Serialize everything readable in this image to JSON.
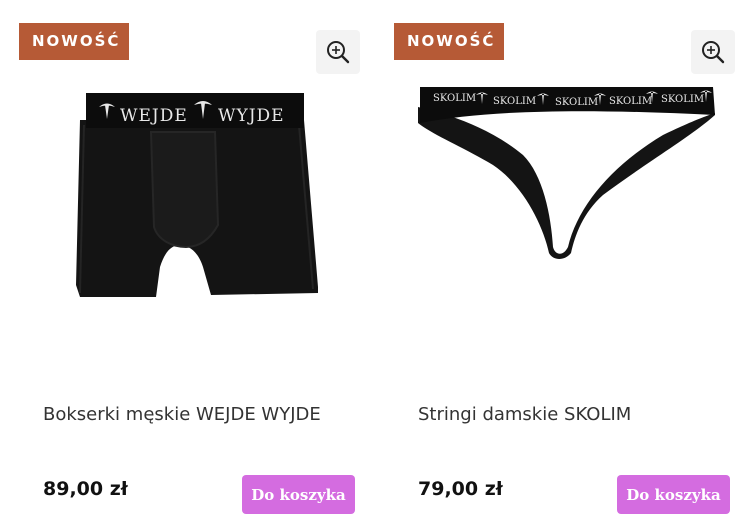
{
  "products": [
    {
      "badge": "NOWOŚĆ",
      "zoom_icon": "zoom-in-icon",
      "image_band_text": [
        "WEJDE",
        "WYJDE"
      ],
      "title": "Bokserki męskie WEJDE WYJDE",
      "price": "89,00 zł",
      "cart_label": "Do koszyka"
    },
    {
      "badge": "NOWOŚĆ",
      "zoom_icon": "zoom-in-icon",
      "image_band_text": [
        "SKOLIM",
        "SKOLIM",
        "SKOLIM",
        "SKOLIM",
        "SKOLIM"
      ],
      "title": "Stringi damskie SKOLIM",
      "price": "79,00 zł",
      "cart_label": "Do koszyka"
    }
  ],
  "colors": {
    "badge_bg": "#b65a36",
    "cart_button_bg": "#d46ce0",
    "garment": "#141414"
  }
}
